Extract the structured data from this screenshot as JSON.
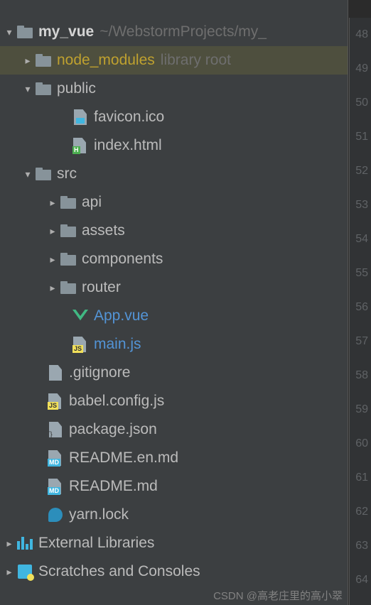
{
  "project": {
    "name": "my_vue",
    "path": "~/WebstormProjects/my_"
  },
  "tree": {
    "node_modules": {
      "label": "node_modules",
      "hint": "library root"
    },
    "public": {
      "label": "public",
      "children": {
        "favicon": "favicon.ico",
        "index": "index.html"
      }
    },
    "src": {
      "label": "src",
      "children": {
        "api": "api",
        "assets": "assets",
        "components": "components",
        "router": "router",
        "app": "App.vue",
        "main": "main.js"
      }
    },
    "files": {
      "gitignore": ".gitignore",
      "babel": "babel.config.js",
      "package": "package.json",
      "readme_en": "README.en.md",
      "readme": "README.md",
      "yarn": "yarn.lock"
    }
  },
  "extras": {
    "external": "External Libraries",
    "scratches": "Scratches and Consoles"
  },
  "line_numbers": [
    "48",
    "49",
    "50",
    "51",
    "52",
    "53",
    "54",
    "55",
    "56",
    "57",
    "58",
    "59",
    "60",
    "61",
    "62",
    "63",
    "64"
  ],
  "watermark": "CSDN @高老庄里的高小翠"
}
